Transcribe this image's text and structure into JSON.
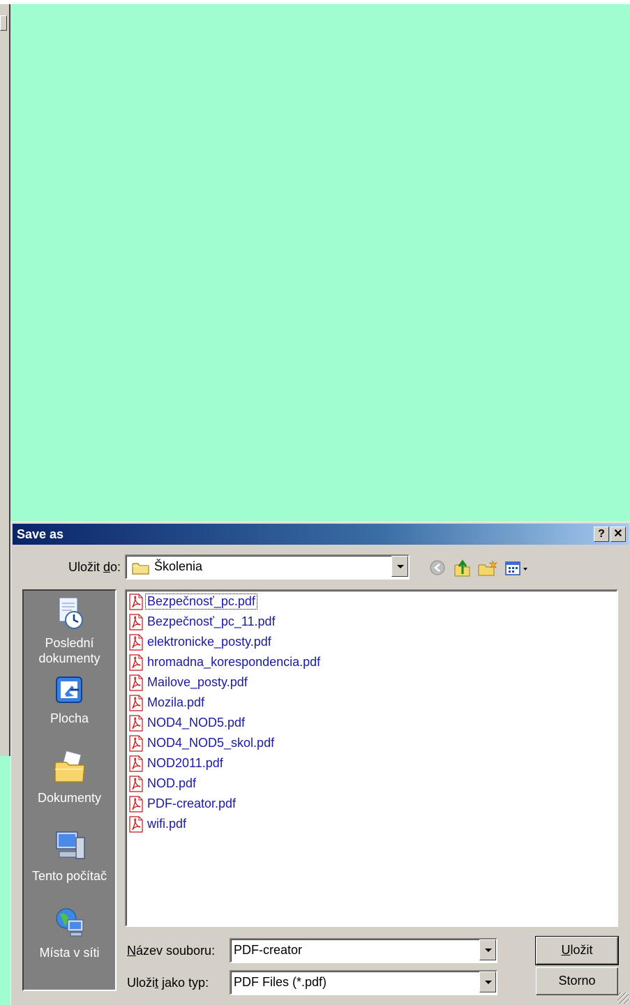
{
  "dialog": {
    "title": "Save as",
    "help_label": "?",
    "close_label": "✕"
  },
  "lookin": {
    "label_pre": "Uložit ",
    "label_key": "d",
    "label_post": "o:",
    "value": "Školenia"
  },
  "toolbar": {
    "icons": [
      "back-icon",
      "up-folder-icon",
      "new-folder-icon",
      "views-menu-icon"
    ]
  },
  "places": [
    {
      "label": "Poslední dokumenty",
      "icon": "recent-documents-icon"
    },
    {
      "label": "Plocha",
      "icon": "desktop-icon"
    },
    {
      "label": "Dokumenty",
      "icon": "my-documents-icon"
    },
    {
      "label": "Tento počítač",
      "icon": "my-computer-icon"
    },
    {
      "label": "Místa v síti",
      "icon": "network-places-icon"
    }
  ],
  "files": [
    "Bezpečnosť_pc.pdf",
    "Bezpečnosť_pc_11.pdf",
    "elektronicke_posty.pdf",
    "hromadna_korespondencia.pdf",
    "Mailove_posty.pdf",
    "Mozila.pdf",
    "NOD4_NOD5.pdf",
    "NOD4_NOD5_skol.pdf",
    "NOD2011.pdf",
    "NOD.pdf",
    "PDF-creator.pdf",
    "wifi.pdf"
  ],
  "filename": {
    "label_key": "N",
    "label_rest": "ázev souboru:",
    "value": "PDF-creator"
  },
  "filetype": {
    "label_pre": "Uloži",
    "label_key": "t",
    "label_post": " jako typ:",
    "value": "PDF Files (*.pdf)"
  },
  "buttons": {
    "save_key": "U",
    "save_rest": "ložit",
    "cancel": "Storno"
  },
  "colors": {
    "background": "#9ffdd0",
    "dialog_face": "#d4d0c8",
    "title_gradient_start": "#0a246a",
    "file_text": "#1a1aa8",
    "places_bar": "#808080"
  }
}
